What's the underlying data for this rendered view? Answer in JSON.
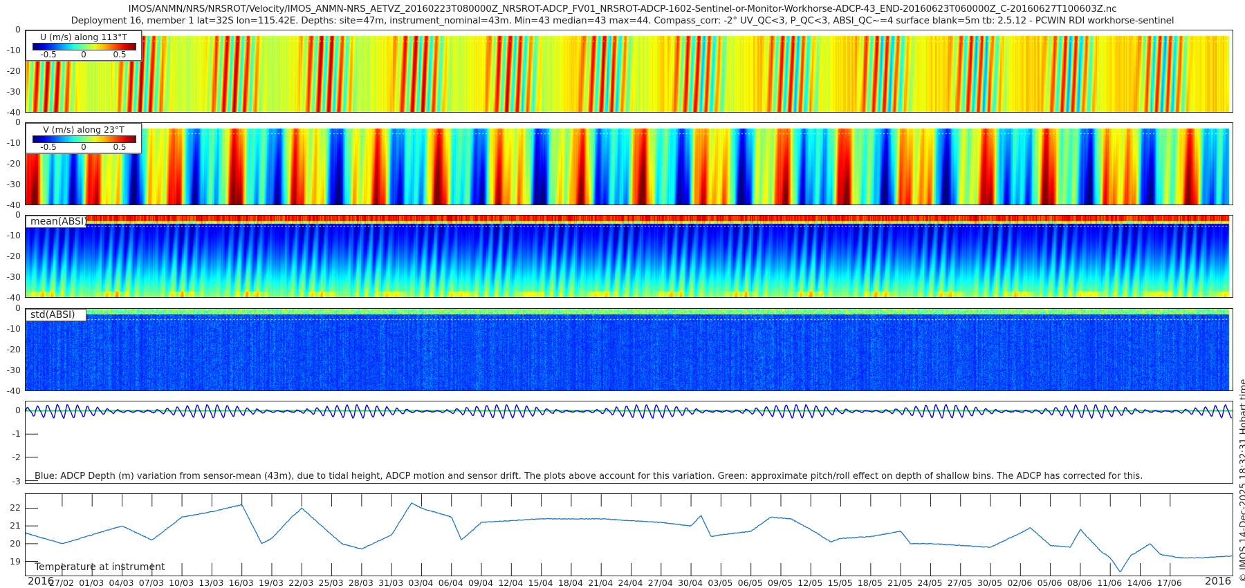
{
  "title_line1": "IMOS/ANMN/NRS/NRSROT/Velocity/IMOS_ANMN-NRS_AETVZ_20160223T080000Z_NRSROT-ADCP_FV01_NRSROT-ADCP-1602-Sentinel-or-Monitor-Workhorse-ADCP-43_END-20160623T060000Z_C-20160627T100603Z.nc",
  "title_line2": "Deployment 16, member 1 lat=32S lon=115.42E. Depths: site=47m, instrument_nominal=43m. Min=43 median=43 max=44. Compass_corr: -2° UV_QC<3, P_QC<3, ABSI_QC~=4 surface blank=5m tb: 2.5.12 - PCWIN RDI workhorse-sentinel",
  "stamp": "© IMOS 14-Dec-2025 18:32:31 Hobart time",
  "chart_data": [
    {
      "type": "heatmap",
      "id": "u",
      "legend_title": "U (m/s) along 113°T",
      "colorbar_ticks": [
        "-0.5",
        "0",
        "0.5"
      ],
      "clim": [
        -0.7,
        0.7
      ],
      "colormap": "jet",
      "yticks": [
        "0",
        "-10",
        "-20",
        "-30",
        "-40"
      ],
      "ylim": [
        -40,
        0
      ],
      "surface_blank_m": 5
    },
    {
      "type": "heatmap",
      "id": "v",
      "legend_title": "V (m/s) along 23°T",
      "colorbar_ticks": [
        "-0.5",
        "0",
        "0.5"
      ],
      "clim": [
        -0.7,
        0.7
      ],
      "colormap": "jet",
      "yticks": [
        "0",
        "-10",
        "-20",
        "-30",
        "-40"
      ],
      "ylim": [
        -40,
        0
      ],
      "surface_blank_m": 5
    },
    {
      "type": "heatmap",
      "id": "mean_absi",
      "legend_title": "mean(ABSI)",
      "colormap": "jet",
      "yticks": [
        "0",
        "-10",
        "-20",
        "-30",
        "-40"
      ],
      "ylim": [
        -40,
        0
      ]
    },
    {
      "type": "heatmap",
      "id": "std_absi",
      "legend_title": "std(ABSI)",
      "colormap": "jet",
      "yticks": [
        "0",
        "-10",
        "-20",
        "-30",
        "-40"
      ],
      "ylim": [
        -40,
        0
      ]
    },
    {
      "type": "line",
      "id": "depth",
      "caption": "Blue: ADCP Depth (m) variation from sensor-mean (43m), due to tidal height, ADCP motion and sensor drift. The plots above account for this variation. Green: approximate pitch/roll effect on depth of shallow bins. The ADCP has corrected for this.",
      "yticks": [
        "0",
        "-1",
        "-2",
        "-3"
      ],
      "ylim": [
        -3.1,
        0.4
      ],
      "series": [
        {
          "color": "#0000ff",
          "tidal_range": [
            -0.35,
            0.3
          ]
        },
        {
          "color": "#33dd33",
          "value": 0
        }
      ]
    },
    {
      "type": "line",
      "id": "temperature",
      "caption": "Temperature at instrument",
      "yticks": [
        "22",
        "21",
        "20",
        "19"
      ],
      "ylim": [
        18.2,
        22.8
      ],
      "color": "#1f77c8",
      "x": [
        "23/02",
        "27/02",
        "01/03",
        "04/03",
        "07/03",
        "10/03",
        "13/03",
        "16/03",
        "18/03",
        "19/03",
        "21/03",
        "22/03",
        "25/03",
        "26/03",
        "28/03",
        "31/03",
        "02/04",
        "03/04",
        "06/04",
        "07/04",
        "09/04",
        "12/04",
        "15/04",
        "18/04",
        "21/04",
        "24/04",
        "27/04",
        "30/04",
        "01/05",
        "02/05",
        "03/05",
        "06/05",
        "08/05",
        "10/05",
        "12/05",
        "14/05",
        "15/05",
        "18/05",
        "21/05",
        "22/05",
        "24/05",
        "27/05",
        "30/05",
        "02/06",
        "03/06",
        "05/06",
        "07/06",
        "08/06",
        "10/06",
        "11/06",
        "12/06",
        "13/06",
        "15/06",
        "16/06",
        "18/06",
        "20/06",
        "23/06"
      ],
      "y": [
        20.6,
        20.0,
        20.5,
        21.0,
        20.2,
        21.5,
        21.8,
        22.2,
        20.0,
        20.3,
        21.5,
        22.0,
        20.5,
        20.0,
        19.7,
        20.5,
        22.3,
        22.0,
        21.5,
        20.2,
        21.2,
        21.3,
        21.4,
        21.4,
        21.4,
        21.3,
        21.2,
        21.0,
        21.6,
        20.4,
        20.5,
        20.7,
        21.5,
        21.4,
        20.8,
        20.1,
        20.3,
        20.4,
        20.7,
        20.0,
        20.0,
        19.9,
        19.8,
        20.6,
        20.9,
        19.9,
        19.8,
        20.8,
        19.6,
        19.2,
        18.4,
        19.3,
        20.0,
        19.4,
        19.2,
        19.2,
        19.3
      ]
    }
  ],
  "xaxis": {
    "xlim": [
      "2016-02-23T08:00",
      "2016-06-23T06:00"
    ],
    "year_left": "2016",
    "year_right": "2016",
    "ticks": [
      "27/02",
      "01/03",
      "04/03",
      "07/03",
      "10/03",
      "13/03",
      "16/03",
      "19/03",
      "22/03",
      "25/03",
      "28/03",
      "31/03",
      "03/04",
      "06/04",
      "09/04",
      "12/04",
      "15/04",
      "18/04",
      "21/04",
      "24/04",
      "27/04",
      "30/04",
      "03/05",
      "06/05",
      "09/05",
      "12/05",
      "15/05",
      "18/05",
      "21/05",
      "24/05",
      "27/05",
      "30/05",
      "02/06",
      "05/06",
      "08/06",
      "11/06",
      "14/06",
      "17/06"
    ]
  }
}
